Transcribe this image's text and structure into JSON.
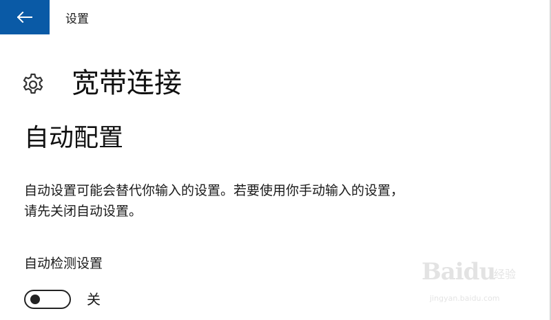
{
  "window": {
    "app_title": "设置",
    "accent_color": "#0a5aa6"
  },
  "header": {
    "icon": "gear-icon",
    "title": "宽带连接"
  },
  "section": {
    "title": "自动配置",
    "description_line1": "自动设置可能会替代你输入的设置。若要使用你手动输入的设置，",
    "description_line2": "请先关闭自动设置。"
  },
  "setting": {
    "label": "自动检测设置",
    "toggle_on": false,
    "toggle_state_label": "关"
  },
  "watermark": {
    "brand": "Baidu",
    "sub": "经验",
    "url": "jingyan.baidu.com"
  }
}
